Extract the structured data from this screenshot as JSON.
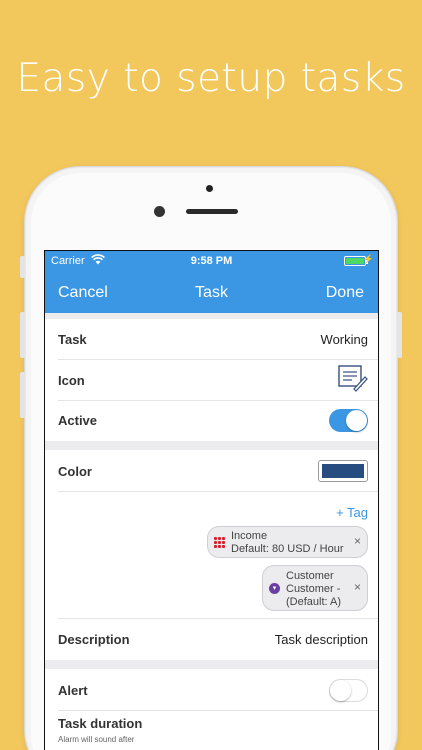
{
  "headline": "Easy to setup tasks",
  "status_bar": {
    "carrier": "Carrier",
    "time": "9:58 PM",
    "battery_level": 1.0
  },
  "nav": {
    "cancel": "Cancel",
    "title": "Task",
    "done": "Done"
  },
  "form": {
    "task": {
      "label": "Task",
      "value": "Working"
    },
    "icon": {
      "label": "Icon",
      "icon_name": "document-pencil-icon"
    },
    "active": {
      "label": "Active",
      "on": true
    },
    "color": {
      "label": "Color",
      "swatch": "#264c80"
    },
    "add_tag": "+ Tag",
    "tags": [
      {
        "line1": "Income",
        "line2": "Default: 80 USD / Hour",
        "icon": "grid-icon",
        "icon_color": "#d6202e"
      },
      {
        "line1": "Customer",
        "line2": "Customer -",
        "line3": "(Default: A)",
        "icon": "chevron-circle-icon",
        "icon_color": "#6a3fa0"
      }
    ],
    "remove": "×",
    "description": {
      "label": "Description",
      "value": "Task description"
    },
    "alert": {
      "label": "Alert",
      "on": false
    },
    "task_duration": {
      "label": "Task duration",
      "hint": "Alarm will sound after"
    }
  },
  "colors": {
    "accent": "#3b97e3",
    "background": "#f2c75c",
    "toggle_on": "#3b97e3",
    "battery": "#4cd964"
  }
}
